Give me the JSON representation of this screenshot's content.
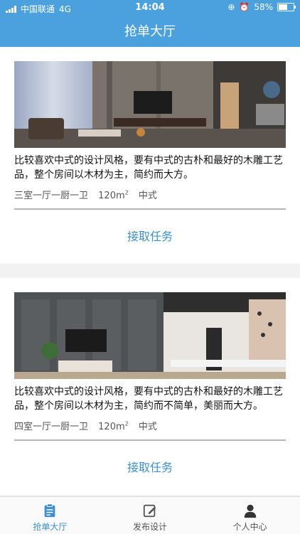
{
  "status_bar": {
    "carrier": "中国联通",
    "network": "4G",
    "time": "14:04",
    "battery": "58%",
    "battery_level": 0.58
  },
  "header": {
    "title": "抢单大厅"
  },
  "tasks": [
    {
      "description": "比较喜欢中式的设计风格，要有中式的古朴和最好的木雕工艺品，整个房间以木材为主，简约而大方。",
      "rooms": "三室一厅一厨一卫",
      "area": "120m",
      "area_sup": "2",
      "style": "中式",
      "action": "接取任务"
    },
    {
      "description": "比较喜欢中式的设计风格，要有中式的古朴和最好的木雕工艺品，整个房间以木材为主，简约而不简单，美丽而大方。",
      "rooms": "四室一厅一厨一卫",
      "area": "120m",
      "area_sup": "2",
      "style": "中式",
      "action": "接取任务"
    }
  ],
  "tabbar": {
    "items": [
      {
        "label": "抢单大厅",
        "icon": "clipboard-icon",
        "active": true
      },
      {
        "label": "发布设计",
        "icon": "edit-icon",
        "active": false
      },
      {
        "label": "个人中心",
        "icon": "person-icon",
        "active": false
      }
    ]
  },
  "colors": {
    "primary": "#4aa1de",
    "accent": "#3c8fcf"
  }
}
